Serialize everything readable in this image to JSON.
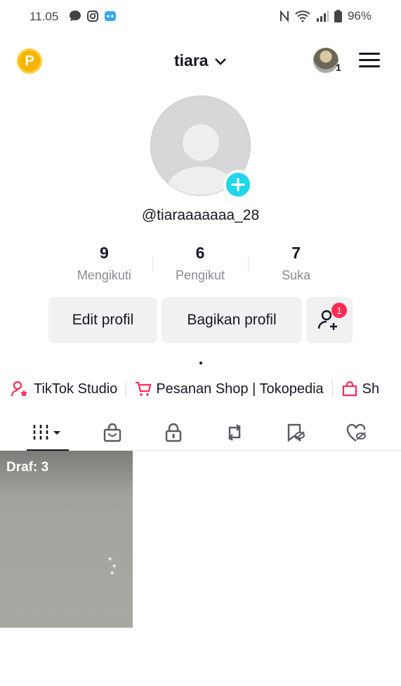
{
  "status_bar": {
    "time": "11.05",
    "battery": "96%",
    "left_icons": [
      "chat-bubble-icon",
      "instagram-icon",
      "app-icon"
    ],
    "right_icons": [
      "nfc-icon",
      "wifi-icon",
      "signal-icon",
      "battery-icon"
    ]
  },
  "header": {
    "coin_letter": "P",
    "username": "tiara",
    "account_count": "1"
  },
  "profile": {
    "handle": "@tiaraaaaaaa_28",
    "stats": [
      {
        "value": "9",
        "label": "Mengikuti"
      },
      {
        "value": "6",
        "label": "Pengikut"
      },
      {
        "value": "7",
        "label": "Suka"
      }
    ],
    "edit_label": "Edit profil",
    "share_label": "Bagikan profil",
    "friend_badge": "1",
    "bio": "."
  },
  "quick_links": [
    {
      "label": "TikTok Studio",
      "icon": "creator-icon"
    },
    {
      "label": "Pesanan Shop | Tokopedia",
      "icon": "cart-icon"
    },
    {
      "label": "Sh",
      "icon": "shop-bag-icon"
    }
  ],
  "tabs": [
    "videos-grid-icon",
    "shop-bag-icon",
    "lock-icon",
    "repost-icon",
    "saved-icon",
    "liked-hidden-icon"
  ],
  "draft": {
    "label": "Draf: 3"
  },
  "colors": {
    "accent": "#fe2c55",
    "add": "#20d5ec",
    "coin": "#f7b500"
  }
}
